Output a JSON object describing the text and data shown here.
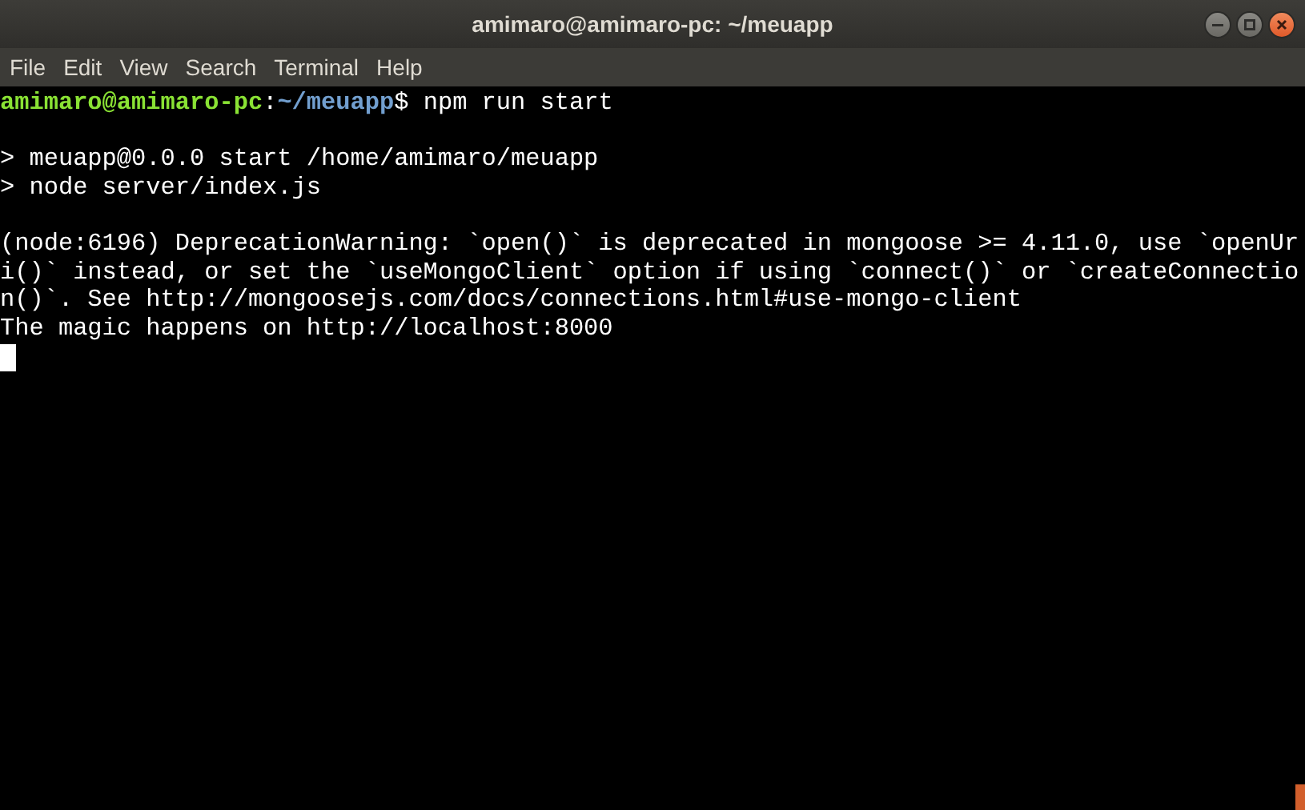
{
  "window": {
    "title": "amimaro@amimaro-pc: ~/meuapp"
  },
  "menu": [
    "File",
    "Edit",
    "View",
    "Search",
    "Terminal",
    "Help"
  ],
  "terminal": {
    "lines": [
      {
        "kind": "prompt",
        "segments": [
          {
            "kind": "user",
            "text": "amimaro@amimaro-pc"
          },
          {
            "kind": "plain",
            "text": ":"
          },
          {
            "kind": "path",
            "text": "~/meuapp"
          },
          {
            "kind": "plain",
            "text": "$ npm run start"
          }
        ]
      },
      {
        "kind": "blank"
      },
      {
        "kind": "output",
        "text": "> meuapp@0.0.0 start /home/amimaro/meuapp"
      },
      {
        "kind": "output",
        "text": "> node server/index.js"
      },
      {
        "kind": "blank"
      },
      {
        "kind": "output",
        "text": "(node:6196) DeprecationWarning: `open()` is deprecated in mongoose >= 4.11.0, use `openUr"
      },
      {
        "kind": "output",
        "text": "i()` instead, or set the `useMongoClient` option if using `connect()` or `createConnectio"
      },
      {
        "kind": "output",
        "text": "n()`. See http://mongoosejs.com/docs/connections.html#use-mongo-client"
      },
      {
        "kind": "output",
        "text": "The magic happens on http://localhost:8000"
      },
      {
        "kind": "cursor"
      }
    ]
  }
}
